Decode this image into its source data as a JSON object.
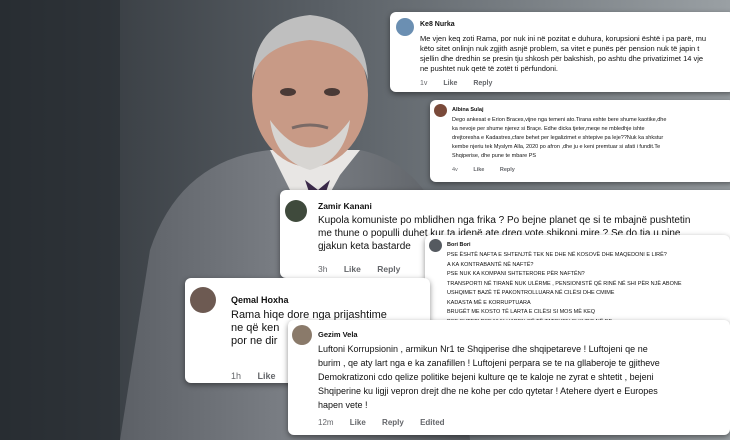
{
  "comments": [
    {
      "author": "Ke8 Nurka",
      "text": "Me vjen keq zoti Rama, por nuk ini në pozitat e duhura, korupsioni është i pa parë, mu\nkëto sitet onlinjn nuk zgjith asnjë problem, sa vitet e punës për pension nuk të japin t\nsjellin dhe dredhin se presin tju shkosh për bakshish, po ashtu dhe privatizimet 14 vje\nne pushtet nuk qetë të zotët ti përfundoni.",
      "time": "1v",
      "like": "Like",
      "reply": "Reply"
    },
    {
      "author": "Albina Sulaj",
      "text": "Dego ankesat e Erion Braces,vijne nga temeni ato.Tirana eshte bere shume kaotike,dhe\nka nevoje per shume njerez si Braçe. Edhe dicka tjeter,meqe ne mbledhje ishte\ndrejtoresha e Kadastres,cfare behet per legalizimet e shtepive pa leje??Nuk ka shkstur\nkembe njeriu tek Myslym Alla, 2020 po afron ,dhe ju e keni premtuar si afati i fundit.Te\nShqiperise, dhe pune te mbare PS",
      "time": "4v",
      "like": "Like",
      "reply": "Reply"
    },
    {
      "author": "Zamir Kanani",
      "text": "Kupola komuniste po mblidhen nga frika ? Po bejne planet qe si te mbajnë pushtetin\nme thune o populli duhet kur ta idenë ate dreq vote shikoni mire ? Se do tia u pine\ngjakun keta bastarde",
      "time": "3h",
      "like": "Like",
      "reply": "Reply"
    },
    {
      "author": "Bori Bori",
      "text": "PSE ËSHTË NAFTA E SHTENJTË TEK NE DHE NË KOSOVË DHE MAQEDONI E LIRË?\nA KA KONTRABANTË NË NAFTË?\nPSE NUK KA KOMPANI SHTETERORE PËR NAFTËN?\nTRANSPORTI NË TIRANË NUK ULËRME , PENSIONISTË QË RINË NË SHI PËR NJË ABONE\nUSHQIMET BAZË TË PAKONTROLLUARA NË CILËSI DHE CMIME\nKADASTA MË E KORRUPTUARA\nBRUGËT ME KOSTO TË LARTA E CILËSI SI MOS MË KEQ\nPSE SHTETI PSE NUK HAPEN QË TË TATOHEN SI KUDO NË BE",
      "time": "",
      "like": "",
      "reply": ""
    },
    {
      "author": "Qemal Hoxha",
      "text": "Rama hiqe dore nga prijashtime\nne që ken\npor ne dir",
      "time": "1h",
      "like": "Like",
      "reply": ""
    },
    {
      "author": "Gezim Vela",
      "text": "Luftoni Korrupsionin , armikun Nr1 te Shqiperise dhe shqipetareve ! Luftojeni qe ne\nburim , qe aty lart nga e ka zanafillen ! Luftojeni perpara se te na gllaberoje te gjitheve\nDemokratizoni cdo qelize politike bejeni kulture qe te kaloje ne zyrat e shtetit , bejeni\nShqiperine ku ligji vepron drejt dhe ne kohe per cdo qytetar ! Atehere dyert e Europes\nhapen vete !",
      "time": "12m",
      "like": "Like",
      "reply": "Reply",
      "edited": "Edited"
    }
  ]
}
